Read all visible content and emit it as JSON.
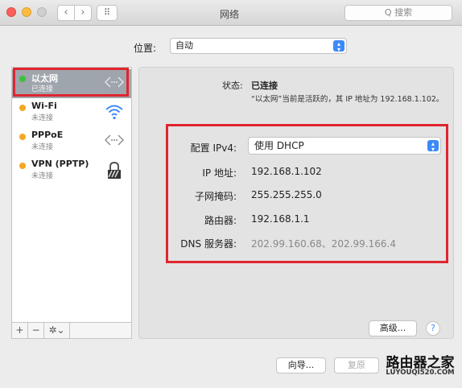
{
  "window": {
    "title": "网络",
    "search_placeholder": "Q 搜索",
    "back_icon": "‹",
    "forward_icon": "›",
    "grid_icon": "⠿"
  },
  "location": {
    "label": "位置:",
    "value": "自动"
  },
  "services": [
    {
      "name": "以太网",
      "status": "已连接",
      "dot_color": "#3cc13b",
      "icon": "ethernet-arrows-icon",
      "glyph": "‹···›"
    },
    {
      "name": "Wi-Fi",
      "status": "未连接",
      "dot_color": "#f5a623",
      "icon": "wifi-icon",
      "glyph": "📶"
    },
    {
      "name": "PPPoE",
      "status": "未连接",
      "dot_color": "#f5a623",
      "icon": "ethernet-arrows-icon",
      "glyph": "‹···›"
    },
    {
      "name": "VPN (PPTP)",
      "status": "未连接",
      "dot_color": "#f5a623",
      "icon": "vpn-lock-icon",
      "glyph": "🔒"
    }
  ],
  "sidebar_controls": {
    "add": "+",
    "remove": "−",
    "gear": "✲⌄"
  },
  "detail": {
    "status_label": "状态:",
    "status_value": "已连接",
    "status_desc": "“以太网”当前是活跃的，其 IP 地址为 192.168.1.102。",
    "config_label": "配置 IPv4:",
    "config_value": "使用 DHCP",
    "ip_label": "IP 地址:",
    "ip_value": "192.168.1.102",
    "mask_label": "子网掩码:",
    "mask_value": "255.255.255.0",
    "router_label": "路由器:",
    "router_value": "192.168.1.1",
    "dns_label": "DNS 服务器:",
    "dns_value": "202.99.160.68、202.99.166.4",
    "advanced_button": "高级...",
    "help_button": "?"
  },
  "footer": {
    "assist_button": "向导...",
    "revert_button": "复原"
  },
  "watermark": {
    "brand": "路由器之家",
    "url": "LUYOUQI520.COM"
  }
}
